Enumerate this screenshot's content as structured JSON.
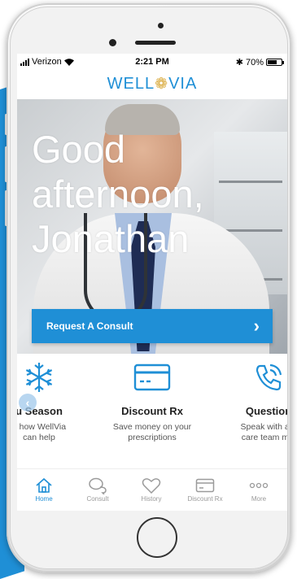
{
  "status_bar": {
    "carrier": "Verizon",
    "time": "2:21 PM",
    "battery": "70%",
    "battery_level": 0.7
  },
  "logo": {
    "left": "WELL",
    "right": "VIA"
  },
  "hero": {
    "greeting_line1": "Good",
    "greeting_line2": "afternoon,",
    "greeting_line3": "Jonathan",
    "cta_label": "Request A Consult",
    "cta_icon": "chevron-right-icon"
  },
  "cards": [
    {
      "icon": "snowflake-icon",
      "title": "u Season",
      "desc_line1": "n how WellVia",
      "desc_line2": "can help"
    },
    {
      "icon": "credit-card-icon",
      "title": "Discount Rx",
      "desc_line1": "Save money on your",
      "desc_line2": "prescriptions"
    },
    {
      "icon": "phone-icon",
      "title": "Question",
      "desc_line1": "Speak with a p",
      "desc_line2": "care team mei"
    }
  ],
  "carousel_prev_icon": "chevron-left-icon",
  "tabbar": {
    "items": [
      {
        "label": "Home",
        "icon": "home-icon",
        "active": true
      },
      {
        "label": "Consult",
        "icon": "chat-icon",
        "active": false
      },
      {
        "label": "History",
        "icon": "heart-icon",
        "active": false
      },
      {
        "label": "Discount Rx",
        "icon": "card-icon",
        "active": false
      },
      {
        "label": "More",
        "icon": "more-icon",
        "active": false
      }
    ]
  },
  "colors": {
    "brand": "#1f8fd6",
    "logo_mark": "#d9a93a",
    "tab_inactive": "#9a9a9a"
  }
}
